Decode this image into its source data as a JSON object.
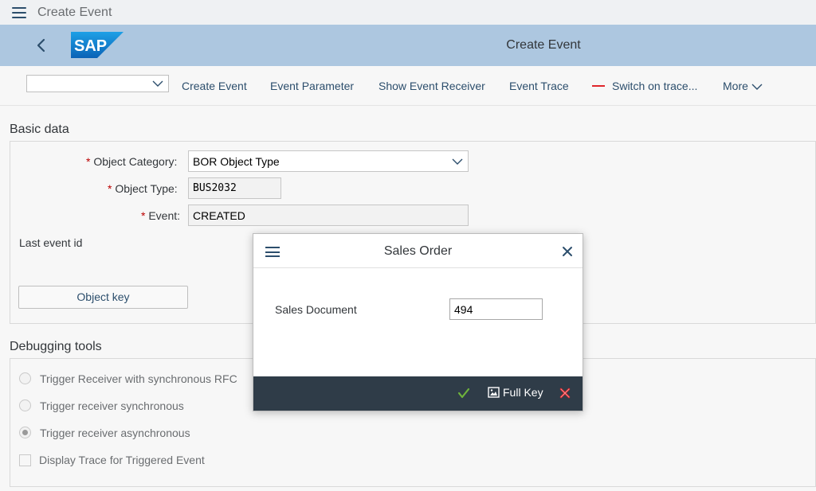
{
  "window": {
    "title": "Create Event"
  },
  "shell": {
    "title": "Create Event",
    "logo_text": "SAP"
  },
  "toolbar": {
    "select_value": "",
    "buttons": [
      "Create Event",
      "Event Parameter",
      "Show Event Receiver",
      "Event Trace",
      "Switch on trace...",
      "More"
    ]
  },
  "basic_data": {
    "title": "Basic data",
    "object_category_label": "Object Category:",
    "object_category_value": "BOR Object Type",
    "object_type_label": "Object Type:",
    "object_type_value": "BUS2032",
    "event_label": "Event:",
    "event_value": "CREATED",
    "last_event_id_label": "Last event id",
    "object_key_button": "Object key",
    "required_mark": "*"
  },
  "debugging": {
    "title": "Debugging tools",
    "options": [
      {
        "label": "Trigger Receiver with synchronous RFC",
        "checked": false
      },
      {
        "label": "Trigger receiver synchronous",
        "checked": false
      },
      {
        "label": "Trigger receiver asynchronous",
        "checked": true
      }
    ],
    "checkbox_label": "Display Trace for Triggered Event",
    "checkbox_checked": false
  },
  "dialog": {
    "title": "Sales Order",
    "field_label": "Sales Document",
    "field_value": "494",
    "full_key_label": "Full Key"
  },
  "colors": {
    "shell": "#adc7e0",
    "link": "#2c4e6c",
    "required": "#bb0000",
    "dialog_footer": "#2f3c48",
    "confirm": "#6fb33c",
    "cancel": "#e0262b"
  }
}
